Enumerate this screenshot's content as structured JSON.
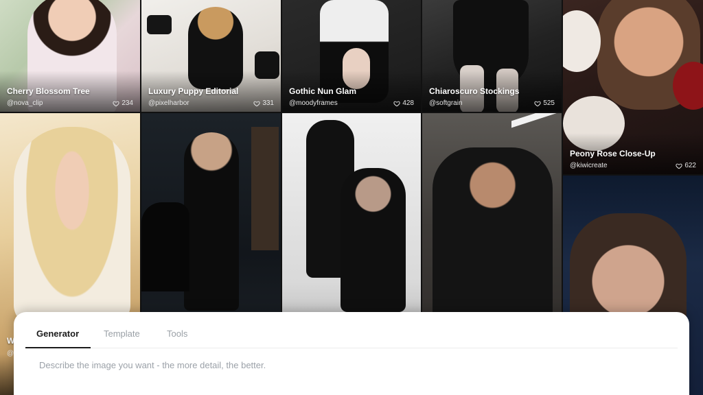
{
  "gallery": [
    {
      "title": "Cherry Blossom Tree",
      "author": "@nova_clip",
      "likes": "234"
    },
    {
      "title": "Luxury Puppy Editorial",
      "author": "@pixelharbor",
      "likes": "331"
    },
    {
      "title": "Gothic Nun Glam",
      "author": "@moodyframes",
      "likes": "428"
    },
    {
      "title": "Chiaroscuro Stockings",
      "author": "@softgrain",
      "likes": "525"
    },
    {
      "title": "Peony Rose Close-Up",
      "author": "@kiwicreate",
      "likes": "622"
    },
    {
      "title": "W",
      "author": "@"
    }
  ],
  "editor": {
    "tabs": [
      "Generator",
      "Template",
      "Tools"
    ],
    "active_tab": "Generator",
    "prompt_placeholder": "Describe the image you want - the more detail, the better."
  },
  "icons": {
    "likes": "heart-outline-icon"
  }
}
